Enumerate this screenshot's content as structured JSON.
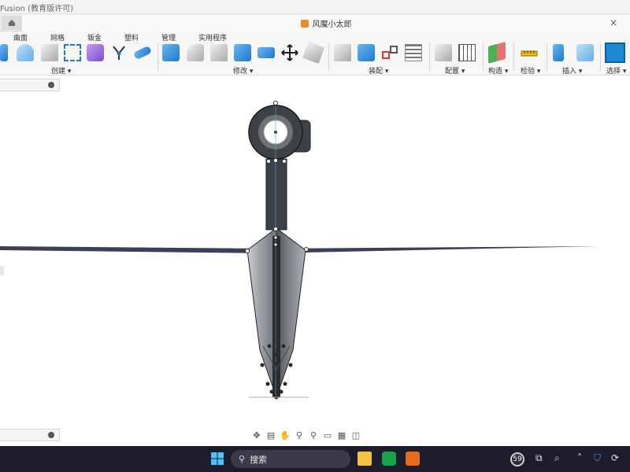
{
  "window": {
    "app_title": "Fusion (教育版许可)",
    "doc_title": "风魔小太郎",
    "close_glyph": "×"
  },
  "toolbar": {
    "tabs": [
      "曲面",
      "网格",
      "钣金",
      "塑料",
      "管理",
      "实用程序"
    ],
    "groups": [
      "创建 ▾",
      "修改 ▾",
      "装配 ▾",
      "配置 ▾",
      "构造 ▾",
      "检验 ▾",
      "插入 ▾",
      "选择 ▾"
    ]
  },
  "navbar": {
    "icons": [
      "orbit-icon",
      "look-at-icon",
      "pan-icon",
      "zoom-icon",
      "zoom-window-icon",
      "display-settings-icon",
      "grid-settings-icon",
      "viewports-icon"
    ]
  },
  "taskbar": {
    "search_label": "搜索",
    "badge_count": "59"
  },
  "colors": {
    "accent": "#1e78d0",
    "model_dark": "#3d4247",
    "taskbar_bg": "#1c1c2b"
  }
}
